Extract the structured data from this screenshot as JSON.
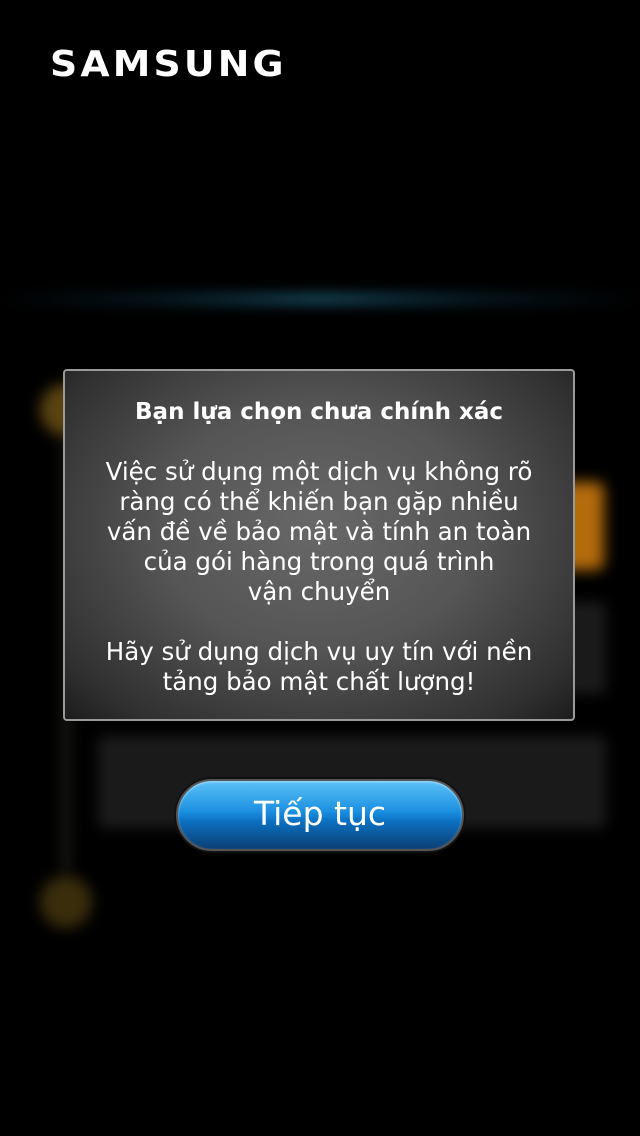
{
  "brand": {
    "logo_text": "SAMSUNG"
  },
  "dialog": {
    "title": "Bạn lựa chọn chưa chính xác",
    "body_lines": [
      "Việc sử dụng một dịch vụ không rõ",
      "ràng có thể khiến bạn gặp nhiều",
      "vấn đề về bảo mật và tính an toàn",
      "của gói hàng trong quá trình",
      "vận chuyển"
    ],
    "advice_lines": [
      "Hãy sử dụng dịch vụ uy tín với nền",
      "tảng bảo mật chất lượng!"
    ]
  },
  "actions": {
    "continue_label": "Tiếp tục"
  },
  "colors": {
    "background": "#000000",
    "button_blue": "#1b8fe0",
    "accent_orange": "#b36b0c",
    "dialog_border": "#9a9a9a"
  }
}
